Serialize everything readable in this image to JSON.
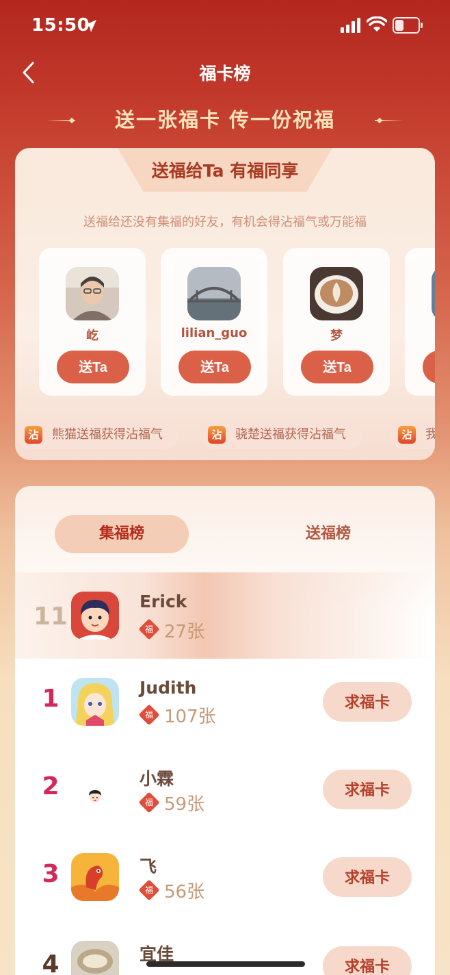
{
  "status_bar": {
    "time": "15:50"
  },
  "nav": {
    "title": "福卡榜"
  },
  "slogan": "送一张福卡 传一份祝福",
  "share_card": {
    "title": "送福给Ta 有福同享",
    "subtitle": "送福给还没有集福的好友，有机会得沾福气或万能福",
    "friends": [
      {
        "name": "屹",
        "button": "送Ta"
      },
      {
        "name": "lilian_guo",
        "button": "送Ta"
      },
      {
        "name": "梦",
        "button": "送Ta"
      }
    ],
    "ticker": [
      {
        "icon": "沾",
        "text": "熊猫送福获得沾福气"
      },
      {
        "icon": "沾",
        "text": "骁楚送福获得沾福气"
      },
      {
        "icon": "沾",
        "text": "我"
      }
    ]
  },
  "leaderboard": {
    "tabs": [
      "集福榜",
      "送福榜"
    ],
    "active_tab": "集福榜",
    "fu_icon": "福",
    "me": {
      "rank": "11",
      "name": "Erick",
      "count": "27张"
    },
    "rows": [
      {
        "rank": "1",
        "name": "Judith",
        "count": "107张",
        "button": "求福卡"
      },
      {
        "rank": "2",
        "name": "小霖",
        "count": "59张",
        "button": "求福卡"
      },
      {
        "rank": "3",
        "name": "飞",
        "count": "56张",
        "button": "求福卡"
      },
      {
        "rank": "4",
        "name": "宜佳",
        "count": "",
        "button": "求福卡"
      }
    ]
  },
  "colors": {
    "primary_red": "#d54a2e",
    "rank_red": "#d4285a",
    "header_red": "#b3271f"
  }
}
